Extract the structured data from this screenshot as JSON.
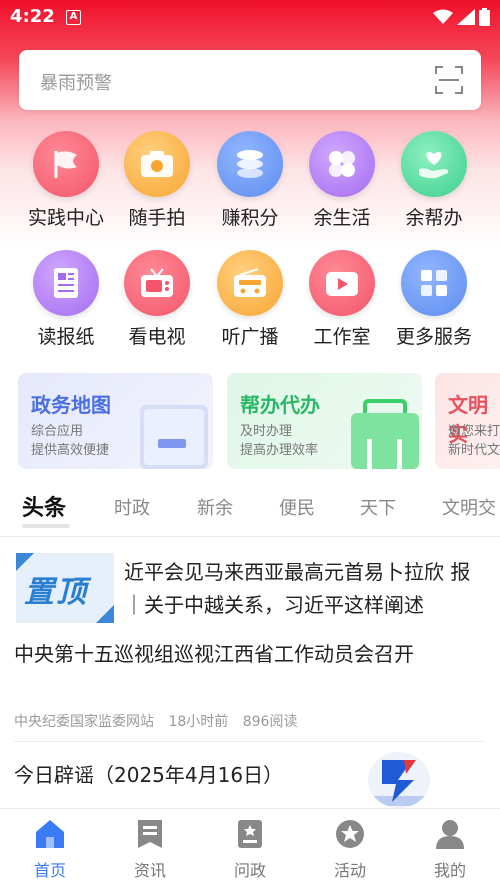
{
  "status_bar": {
    "time": "4:22",
    "notif_icon": "A"
  },
  "search": {
    "placeholder": "暴雨预警",
    "scan_icon": "scan-icon"
  },
  "grid": [
    {
      "label": "实践中心",
      "icon": "flag-icon",
      "color": "#f3556a"
    },
    {
      "label": "随手拍",
      "icon": "camera-icon",
      "color": "#f8a531"
    },
    {
      "label": "赚积分",
      "icon": "coins-icon",
      "color": "#5b8def"
    },
    {
      "label": "余生活",
      "icon": "clover-icon",
      "color": "#a46cf0"
    },
    {
      "label": "余帮办",
      "icon": "heart-hand-icon",
      "color": "#3bcf8e"
    },
    {
      "label": "读报纸",
      "icon": "newspaper-icon",
      "color": "#a46cf0"
    },
    {
      "label": "看电视",
      "icon": "tv-icon",
      "color": "#f3556a"
    },
    {
      "label": "听广播",
      "icon": "radio-icon",
      "color": "#f8a531"
    },
    {
      "label": "工作室",
      "icon": "video-icon",
      "color": "#f3556a"
    },
    {
      "label": "更多服务",
      "icon": "grid-apps-icon",
      "color": "#5b8def"
    }
  ],
  "cards": [
    {
      "title": "政务地图",
      "sub1": "综合应用",
      "sub2": "提供高效便捷",
      "color": "#4a6fe3"
    },
    {
      "title": "帮办代办",
      "sub1": "及时办理",
      "sub2": "提高办理效率",
      "color": "#28b865"
    },
    {
      "title": "文明实",
      "sub1": "邀您来打",
      "sub2": "新时代文",
      "color": "#e8505b"
    }
  ],
  "tabs": [
    "头条",
    "时政",
    "新余",
    "便民",
    "天下",
    "文明交"
  ],
  "pinned": {
    "badge": "置顶",
    "text": "近平会见马来西亚最高元首易卜拉欣 报｜关于中越关系，习近平这样阐述"
  },
  "news": [
    {
      "title": "中央第十五巡视组巡视江西省工作动员会召开",
      "source": "中央纪委国家监委网站",
      "time": "18小时前",
      "reads": "896阅读"
    },
    {
      "title": "今日辟谣（2025年4月16日）"
    }
  ],
  "bottom_nav": [
    {
      "label": "首页",
      "icon": "home-icon"
    },
    {
      "label": "资讯",
      "icon": "bookmark-news-icon"
    },
    {
      "label": "问政",
      "icon": "inquiry-icon"
    },
    {
      "label": "活动",
      "icon": "star-badge-icon"
    },
    {
      "label": "我的",
      "icon": "user-icon"
    }
  ],
  "accent": "#3a7bf5"
}
